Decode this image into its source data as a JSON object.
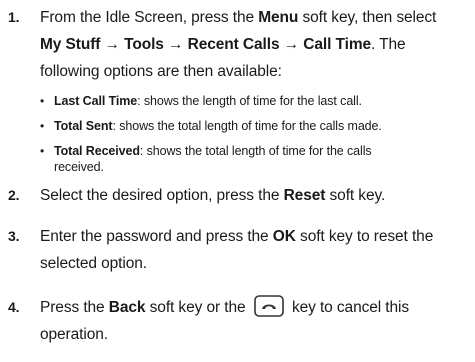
{
  "steps": [
    {
      "number": "1.",
      "parts": [
        {
          "text": "From the Idle Screen, press the ",
          "bold": false
        },
        {
          "text": "Menu",
          "bold": true
        },
        {
          "text": " soft key, then select",
          "bold": false
        }
      ],
      "line2": [
        {
          "text": "My Stuff → Tools → Recent Calls → Call Time",
          "bold": true
        },
        {
          "text": ". The",
          "bold": false
        }
      ],
      "line3": "following options are then available:"
    },
    {
      "number": "2.",
      "parts": [
        {
          "text": "Select the desired option, press the ",
          "bold": false
        },
        {
          "text": "Reset",
          "bold": true
        },
        {
          "text": " soft key.",
          "bold": false
        }
      ]
    },
    {
      "number": "3.",
      "parts": [
        {
          "text": "Enter the password and press the ",
          "bold": false
        },
        {
          "text": "OK",
          "bold": true
        },
        {
          "text": " soft key to reset the",
          "bold": false
        }
      ],
      "line2_plain": "selected option."
    },
    {
      "number": "4.",
      "parts": [
        {
          "text": "Press the ",
          "bold": false
        },
        {
          "text": "Back",
          "bold": true
        },
        {
          "text": " soft key or the",
          "bold": false
        },
        {
          "text": "key to cancel this",
          "bold": false
        }
      ],
      "line2_plain": "operation.",
      "key_icon": "end-key-icon"
    }
  ],
  "options": [
    {
      "title": "Last Call Time",
      "desc": ": shows the length of time for the last call."
    },
    {
      "title": "Total Sent",
      "desc": ": shows the total length of time for the calls made."
    },
    {
      "title": "Total Received",
      "desc": ": shows the total length of time for the calls",
      "desc2": "received."
    }
  ],
  "bullet_glyph": "•"
}
